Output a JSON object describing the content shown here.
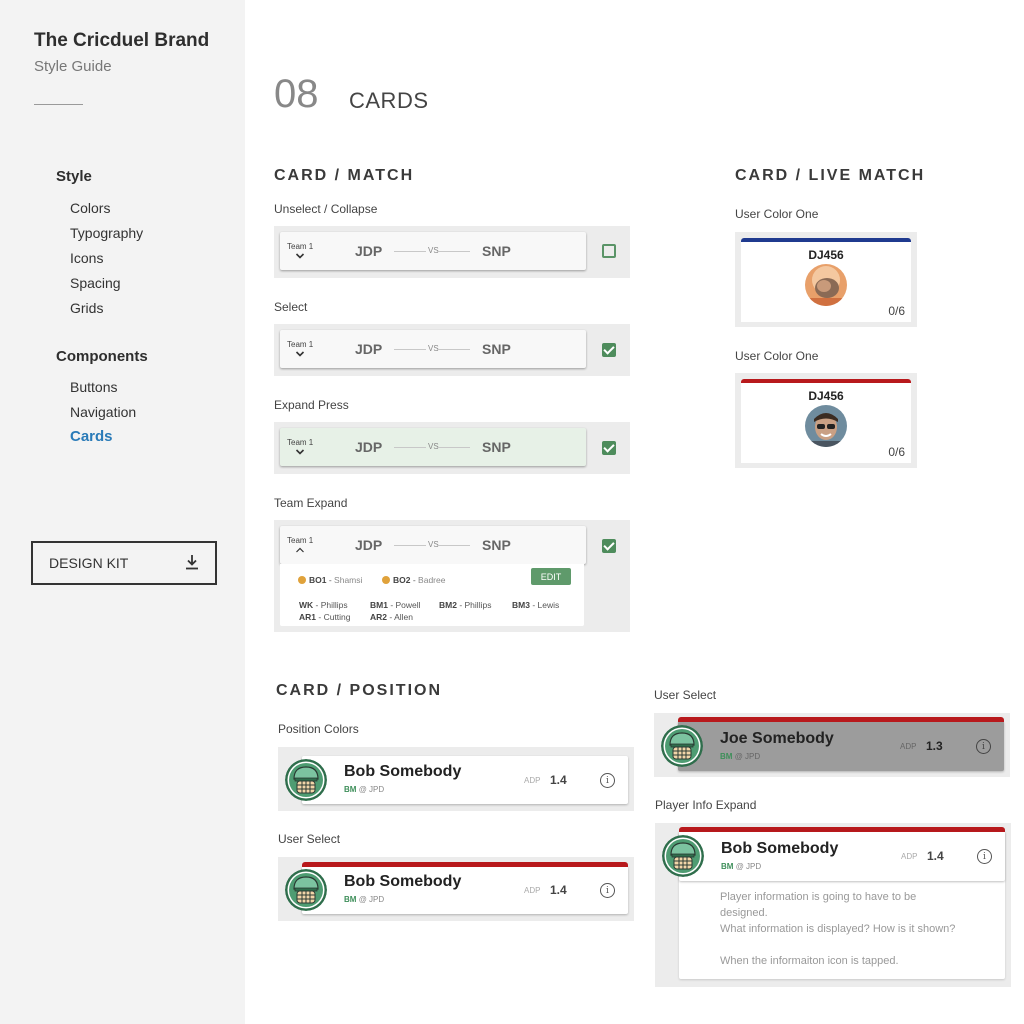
{
  "sidebar": {
    "brand_title": "The Cricduel Brand",
    "brand_subtitle": "Style Guide",
    "style_heading": "Style",
    "style_items": [
      "Colors",
      "Typography",
      "Icons",
      "Spacing",
      "Grids"
    ],
    "components_heading": "Components",
    "component_items": [
      "Buttons",
      "Navigation",
      "Cards"
    ],
    "active_item": "Cards",
    "design_kit_label": "DESIGN KIT"
  },
  "page": {
    "number": "08",
    "title": "CARDS"
  },
  "match_section": {
    "title": "CARD / MATCH",
    "states": [
      {
        "caption": "Unselect / Collapse",
        "team_label": "Team 1",
        "team_a": "JDP",
        "vs": "VS",
        "team_b": "SNP",
        "checked": false
      },
      {
        "caption": "Select",
        "team_label": "Team 1",
        "team_a": "JDP",
        "vs": "VS",
        "team_b": "SNP",
        "checked": true
      },
      {
        "caption": "Expand Press",
        "team_label": "Team 1",
        "team_a": "JDP",
        "vs": "VS",
        "team_b": "SNP",
        "checked": true
      },
      {
        "caption": "Team Expand",
        "team_label": "Team 1",
        "team_a": "JDP",
        "vs": "VS",
        "team_b": "SNP",
        "checked": true
      }
    ],
    "lineup": {
      "bowlers": [
        {
          "pos": "BO1",
          "name": "Shamsi"
        },
        {
          "pos": "BO2",
          "name": "Badree"
        }
      ],
      "edit_label": "EDIT",
      "row1": [
        {
          "pos": "WK",
          "name": "Phillips"
        },
        {
          "pos": "BM1",
          "name": "Powell"
        },
        {
          "pos": "BM2",
          "name": "Phillips"
        },
        {
          "pos": "BM3",
          "name": "Lewis"
        }
      ],
      "row2": [
        {
          "pos": "AR1",
          "name": "Cutting"
        },
        {
          "pos": "AR2",
          "name": "Allen"
        }
      ]
    }
  },
  "live_section": {
    "title": "CARD / LIVE MATCH",
    "cards": [
      {
        "caption": "User Color One",
        "name": "DJ456",
        "score": "0/6",
        "bar_color": "#1f3a8f"
      },
      {
        "caption": "User Color One",
        "name": "DJ456",
        "score": "0/6",
        "bar_color": "#b8191c"
      }
    ]
  },
  "position_section": {
    "title": "CARD / POSITION",
    "position_colors_caption": "Position Colors",
    "user_select_caption": "User Select",
    "user_select_caption_right": "User Select",
    "player_info_caption": "Player Info Expand",
    "players": {
      "bob": {
        "name": "Bob Somebody",
        "pos": "BM",
        "team": "@ JPD",
        "adp_label": "ADP",
        "adp": "1.4"
      },
      "joe": {
        "name": "Joe Somebody",
        "pos": "BM",
        "team": "@ JPD",
        "adp_label": "ADP",
        "adp": "1.3"
      }
    },
    "info_glyph": "i",
    "expand_lines": [
      "Player information is going to have to be",
      "designed.",
      "What information is displayed? How is it shown?",
      "",
      "When the informaiton icon is tapped."
    ]
  },
  "colors": {
    "accent_blue": "#2a7bb8",
    "green": "#4e8c5c",
    "red": "#b8191c",
    "navy": "#1f3a8f"
  },
  "icons": {
    "download": "download-icon",
    "chevron": "chevron-down-icon",
    "info": "info-icon",
    "checkbox": "checkbox-icon"
  }
}
